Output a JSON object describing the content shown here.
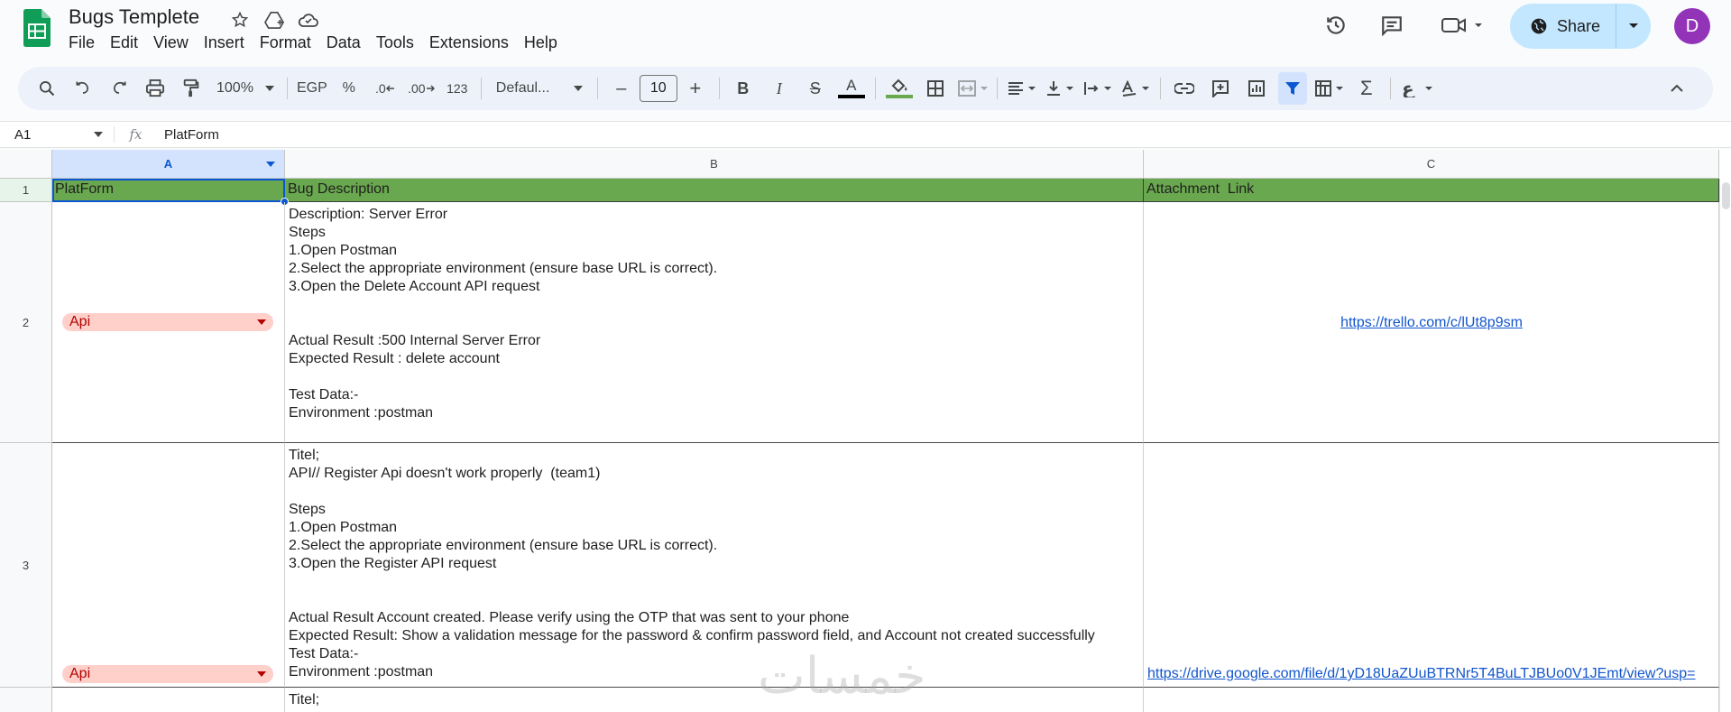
{
  "app": {
    "doc_title": "Bugs Templete",
    "menu": [
      "File",
      "Edit",
      "View",
      "Insert",
      "Format",
      "Data",
      "Tools",
      "Extensions",
      "Help"
    ],
    "share_label": "Share",
    "avatar_initial": "D",
    "colors": {
      "share_bg": "#c2e7ff",
      "avatar": "#9334b8",
      "header_green": "#6aa84f",
      "chip_bg": "#ffcfc9",
      "chip_text": "#b10202"
    }
  },
  "toolbar": {
    "zoom": "100%",
    "currency": "EGP",
    "percent": "%",
    "dec_decrease": ".0",
    "dec_increase": ".00",
    "number_format": "123",
    "font": "Defaul...",
    "font_size": "10",
    "minus": "–",
    "plus": "+",
    "bold": "B",
    "italic": "I",
    "text_color_letter": "A",
    "sigma": "Σ"
  },
  "formula": {
    "cell_ref": "A1",
    "fx_label": "fx",
    "content": "PlatForm"
  },
  "sheet": {
    "columns": [
      "A",
      "B",
      "C"
    ],
    "rows": [
      "1",
      "2",
      "3"
    ],
    "header": [
      "PlatForm",
      "Bug Description",
      "Attachment  Link"
    ],
    "row2": {
      "platform": "Api",
      "description": "Description: Server Error\nSteps\n1.Open Postman\n2.Select the appropriate environment (ensure base URL is correct).\n3.Open the Delete Account API request\n\n\nActual Result :500 Internal Server Error\nExpected Result : delete account\n\nTest Data:-\nEnvironment :postman",
      "link": "https://trello.com/c/lUt8p9sm"
    },
    "row3": {
      "platform": "Api",
      "description": "Titel;\nAPI// Register Api doesn't work properly  (team1)\n\nSteps\n1.Open Postman\n2.Select the appropriate environment (ensure base URL is correct).\n3.Open the Register API request\n\n\nActual Result Account created. Please verify using the OTP that was sent to your phone\nExpected Result: Show a validation message for the password & confirm password field, and Account not created successfully\nTest Data:-\nEnvironment :postman",
      "link": "https://drive.google.com/file/d/1yD18UaZUuBTRNr5T4BuLTJBUo0V1JEmt/view?usp="
    },
    "row4": {
      "description": "Titel;"
    }
  },
  "watermark": "خمسات"
}
